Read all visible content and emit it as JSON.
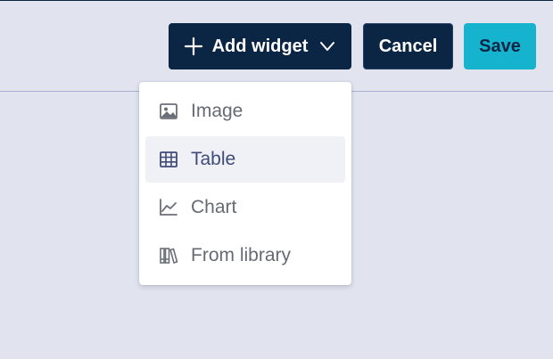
{
  "toolbar": {
    "add_widget_label": "Add widget",
    "cancel_label": "Cancel",
    "save_label": "Save"
  },
  "menu": {
    "items": [
      {
        "label": "Image",
        "icon": "image-icon",
        "selected": false
      },
      {
        "label": "Table",
        "icon": "table-icon",
        "selected": true
      },
      {
        "label": "Chart",
        "icon": "line-chart-icon",
        "selected": false
      },
      {
        "label": "From library",
        "icon": "library-icon",
        "selected": false
      }
    ]
  },
  "colors": {
    "background": "#e1e4ee",
    "primary_button": "#0b2545",
    "save_button": "#16b3ce",
    "menu_highlight": "#eff1f6"
  }
}
